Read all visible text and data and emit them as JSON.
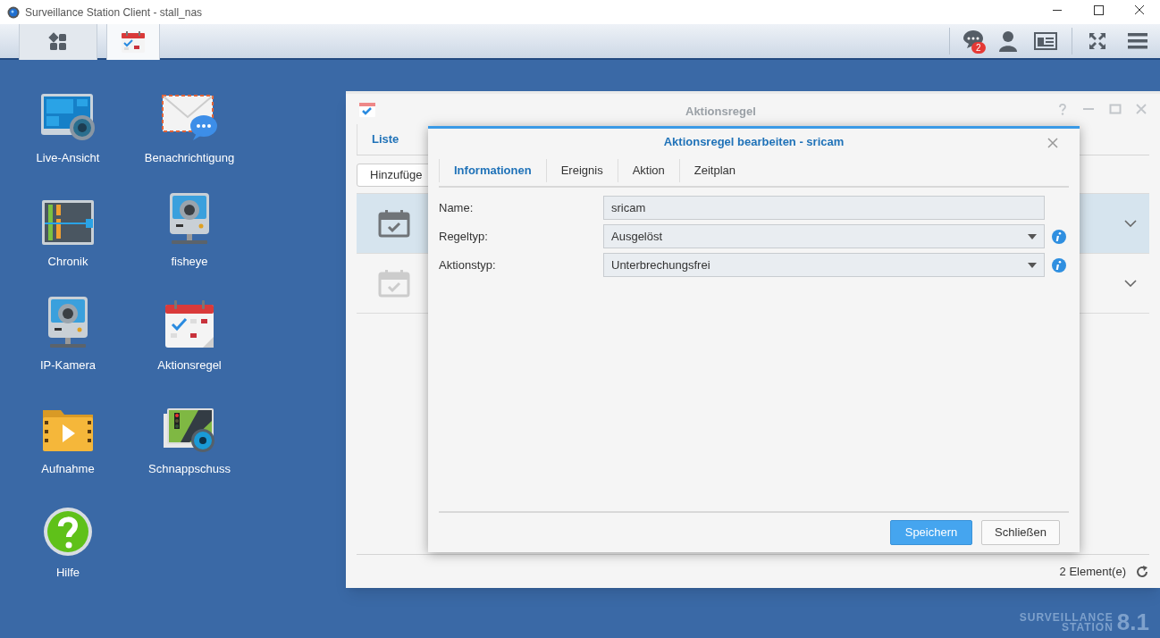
{
  "window": {
    "title": "Surveillance Station Client - stall_nas"
  },
  "taskbar": {
    "apps": [
      {
        "kind": "main-menu",
        "selected": false
      },
      {
        "kind": "action-rule",
        "selected": true
      }
    ],
    "notification_count": "2"
  },
  "desktop_icons": [
    {
      "label": "Live-Ansicht",
      "kind": "live"
    },
    {
      "label": "Benachrichtigung",
      "kind": "mail"
    },
    {
      "label": "Chronik",
      "kind": "timeline"
    },
    {
      "label": "fisheye",
      "kind": "camera"
    },
    {
      "label": "IP-Kamera",
      "kind": "camera"
    },
    {
      "label": "Aktionsregel",
      "kind": "calendar"
    },
    {
      "label": "Aufnahme",
      "kind": "folder"
    },
    {
      "label": "Schnappschuss",
      "kind": "snapshot"
    },
    {
      "label": "Hilfe",
      "kind": "help"
    }
  ],
  "app_window": {
    "title": "Aktionsregel",
    "tabs": [
      {
        "label": "Liste",
        "selected": true
      }
    ],
    "add_button": "Hinzufüge",
    "rows": [
      {
        "selected": true,
        "disabled": false
      },
      {
        "selected": false,
        "disabled": true
      }
    ],
    "footer": "2 Element(e)"
  },
  "dialog": {
    "title": "Aktionsregel bearbeiten - sricam",
    "tabs": [
      {
        "label": "Informationen",
        "selected": true
      },
      {
        "label": "Ereignis",
        "selected": false
      },
      {
        "label": "Aktion",
        "selected": false
      },
      {
        "label": "Zeitplan",
        "selected": false
      }
    ],
    "fields": [
      {
        "label": "Name:",
        "value": "sricam",
        "kind": "text"
      },
      {
        "label": "Regeltyp:",
        "value": "Ausgelöst",
        "kind": "select"
      },
      {
        "label": "Aktionstyp:",
        "value": "Unterbrechungsfrei",
        "kind": "select"
      }
    ],
    "buttons": [
      {
        "label": "Speichern",
        "kind": "primary"
      },
      {
        "label": "Schließen",
        "kind": "default"
      }
    ]
  },
  "branding": {
    "line1": "SURVEILLANCE",
    "line2": "STATION",
    "version": "8.1"
  }
}
